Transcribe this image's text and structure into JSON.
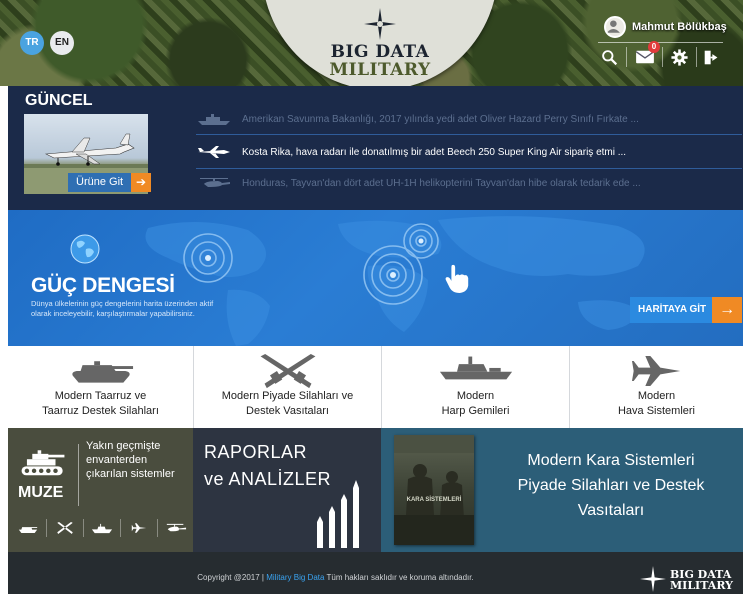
{
  "header": {
    "logo_line1": "BIG DATA",
    "logo_line2": "MILITARY",
    "languages": [
      "TR",
      "EN"
    ],
    "user_name": "Mahmut Bölükbaş",
    "message_count": "0",
    "icons": [
      "search-icon",
      "mail-icon",
      "gear-icon",
      "logout-icon"
    ]
  },
  "guncel": {
    "title": "GÜNCEL",
    "product_button": "Ürüne Git",
    "news": [
      {
        "icon": "ship-icon",
        "text": "Amerikan Savunma Bakanlığı, 2017 yılında yedi adet Oliver Hazard Perry Sınıfı Fırkate ...",
        "active": false
      },
      {
        "icon": "plane-icon",
        "text": "Kosta Rika, hava radarı ile donatılmış bir adet Beech 250 Super King Air sipariş etmi ...",
        "active": true
      },
      {
        "icon": "helicopter-icon",
        "text": "Honduras, Tayvan'dan dört adet UH-1H helikopterini Tayvan'dan hibe olarak tedarik ede ...",
        "active": false
      }
    ]
  },
  "guc": {
    "title": "GÜÇ DENGESİ",
    "description": "Dünya ülkelerinin güç dengelerini harita üzerinden aktif olarak inceleyebilir, karşılaştırmalar yapabilirsiniz.",
    "map_button": "HARİTAYA GİT"
  },
  "categories": [
    {
      "icon": "tank-icon",
      "line1": "Modern Taarruz ve",
      "line2": "Taarruz Destek Silahları"
    },
    {
      "icon": "crossed-rifles-icon",
      "line1": "Modern Piyade Silahları ve",
      "line2": "Destek Vasıtaları"
    },
    {
      "icon": "warship-icon",
      "line1": "Modern",
      "line2": "Harp Gemileri"
    },
    {
      "icon": "fighter-jet-icon",
      "line1": "Modern",
      "line2": "Hava Sistemleri"
    }
  ],
  "muze": {
    "label": "MUZE",
    "description": "Yakın geçmişte envanterden çıkarılan sistemler",
    "icons": [
      "tank-icon",
      "rifles-icon",
      "ship-icon",
      "jet-icon",
      "helicopter-icon"
    ]
  },
  "raporlar": {
    "line1": "RAPORLAR",
    "line2": "ve ANALİZLER"
  },
  "kara": {
    "line1": "Modern Kara Sistemleri",
    "line2": "Piyade Silahları ve Destek",
    "line3": "Vasıtaları",
    "book_title": "KARA SİSTEMLERİ"
  },
  "footer": {
    "copyright_prefix": "Copyright @2017 |",
    "copyright_link": "Military Big Data",
    "copyright_suffix": "Tüm hakları saklıdır ve koruma altındadır.",
    "logo_line1": "BIG DATA",
    "logo_line2": "MILITARY"
  },
  "colors": {
    "navy": "#1b2a49",
    "blue": "#2a7dd4",
    "orange": "#f08a24",
    "olive": "#4a4d3e",
    "slate": "#2d3441",
    "teal": "#2c5e78",
    "footer": "#262c30"
  }
}
